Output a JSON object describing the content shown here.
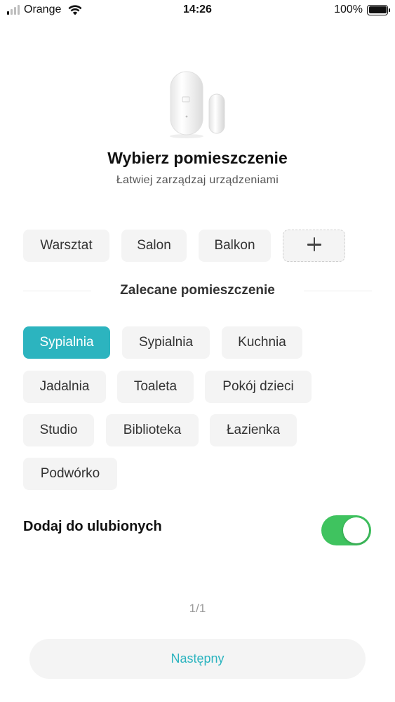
{
  "status_bar": {
    "carrier": "Orange",
    "time": "14:26",
    "battery": "100%",
    "signal_bars_active": 1,
    "signal_bars_total": 4
  },
  "header": {
    "device_icon": "door-window-sensor-icon",
    "title": "Wybierz pomieszczenie",
    "subtitle": "Łatwiej zarządzaj urządzeniami"
  },
  "rooms": [
    "Warsztat",
    "Salon",
    "Balkon"
  ],
  "add_room_icon": "plus-icon",
  "recommended": {
    "title": "Zalecane pomieszczenie",
    "items": [
      "Sypialnia",
      "Sypialnia",
      "Kuchnia",
      "Jadalnia",
      "Toaleta",
      "Pokój dzieci",
      "Studio",
      "Biblioteka",
      "Łazienka",
      "Podwórko"
    ],
    "selected_index": 0
  },
  "favorites": {
    "label": "Dodaj do ulubionych",
    "enabled": true
  },
  "pager": "1/1",
  "next_button": "Następny",
  "colors": {
    "accent": "#2cb4bf",
    "toggle_on": "#3fc35f",
    "chip_bg": "#f4f4f4"
  }
}
